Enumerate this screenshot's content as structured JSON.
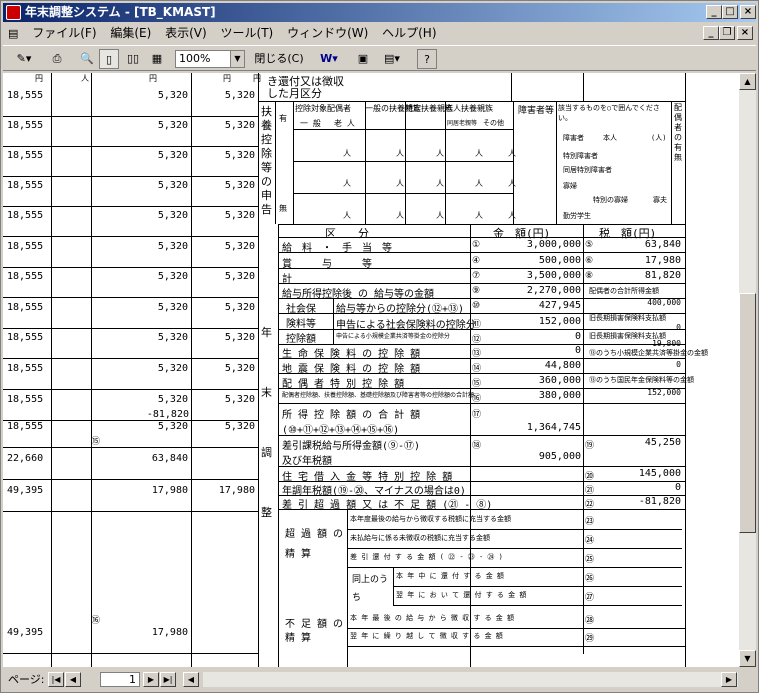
{
  "window": {
    "title": "年末調整システム - [TB_KMAST]"
  },
  "menu": [
    "ファイル(F)",
    "編集(E)",
    "表示(V)",
    "ツール(T)",
    "ウィンドウ(W)",
    "ヘルプ(H)"
  ],
  "toolbar": {
    "zoom": "100%",
    "close_label": "閉じる(C)"
  },
  "left_rows": [
    {
      "a": "18,555",
      "b": "5,320",
      "c": "",
      "d": "5,320"
    },
    {
      "a": "18,555",
      "b": "5,320",
      "c": "",
      "d": "5,320"
    },
    {
      "a": "18,555",
      "b": "5,320",
      "c": "",
      "d": "5,320"
    },
    {
      "a": "18,555",
      "b": "5,320",
      "c": "",
      "d": "5,320"
    },
    {
      "a": "18,555",
      "b": "5,320",
      "c": "",
      "d": "5,320"
    },
    {
      "a": "18,555",
      "b": "5,320",
      "c": "",
      "d": "5,320"
    },
    {
      "a": "18,555",
      "b": "5,320",
      "c": "",
      "d": "5,320"
    },
    {
      "a": "18,555",
      "b": "5,320",
      "c": "",
      "d": "5,320"
    },
    {
      "a": "18,555",
      "b": "5,320",
      "c": "",
      "d": "5,320"
    },
    {
      "a": "18,555",
      "b": "5,320",
      "c": "",
      "d": "5,320"
    },
    {
      "a": "18,555",
      "b": "5,320",
      "c": "",
      "d": "5,320"
    },
    {
      "a": "18,555",
      "b": "5,320",
      "c": "-81,820",
      "d": "5,320"
    },
    {
      "a": "22,660",
      "b": "63,840",
      "c": "",
      "d": ""
    },
    {
      "a": "49,395",
      "b": "17,980",
      "c": "",
      "d": "17,980"
    },
    {
      "a": "49,395",
      "b": "17,980",
      "c": "",
      "d": ""
    }
  ],
  "header_marks": {
    "en1": "円",
    "hito": "人",
    "en2": "円",
    "en3": "円",
    "en4": "円"
  },
  "top_text": {
    "line1": "き還付又は徴収",
    "line2": "した月区分"
  },
  "deps": {
    "side": "扶養控除等の申告",
    "col1": "控除対象配偶者",
    "col1a": "一 般",
    "col1b": "老 人",
    "col2": "一般の扶養親族",
    "col3": "特定扶養親族",
    "col4": "老人扶養親族",
    "col4a": "同居老親等",
    "col4b": "その他",
    "col5": "障害者等",
    "col6": "該当するものを○で囲んでください。",
    "col7": "配偶者の有無",
    "row_labels": [
      "有",
      "無"
    ],
    "unit": "人",
    "notes": [
      "障害者",
      "本人",
      "配偶者",
      "(人)",
      "特別障害者",
      "同居特別障害者",
      "寡婦",
      "特別の寡婦",
      "寡夫",
      "勤労学生"
    ]
  },
  "calc": {
    "h_kubun": "区　　分",
    "h_kingaku": "金　額(円)",
    "h_zeigaku": "税　額(円)",
    "rows": [
      {
        "label": "給　料　・　手　当　等",
        "n1": "①",
        "amt": "3,000,000",
        "n2": "⑤",
        "tax": "63,840"
      },
      {
        "label": "賞　　　与　　　等",
        "n1": "④",
        "amt": "500,000",
        "n2": "⑥",
        "tax": "17,980"
      },
      {
        "label": "計",
        "n1": "⑦",
        "amt": "3,500,000",
        "n2": "⑧",
        "tax": "81,820"
      },
      {
        "label": "給与所得控除後 の 給与等の金額",
        "n1": "⑨",
        "amt": "2,270,000",
        "n2": "",
        "tax": ""
      },
      {
        "label": "給与等からの控除分(⑫+⑬)",
        "n1": "⑩",
        "amt": "427,945",
        "n2": "",
        "tax": ""
      },
      {
        "label": "申告による社会保険料の控除分",
        "n1": "⑪",
        "amt": "152,000",
        "n2": "",
        "tax": ""
      },
      {
        "label": "申告による小規模企業共済等掛金の控除分",
        "n1": "⑫",
        "amt": "0",
        "n2": "",
        "tax": ""
      },
      {
        "label": "生 命 保 険 料 の 控 除 額",
        "n1": "⑬",
        "amt": "0",
        "n2": "",
        "tax": ""
      },
      {
        "label": "地 震 保 険 料 の 控 除 額",
        "n1": "⑭",
        "amt": "44,800",
        "n2": "",
        "tax": ""
      },
      {
        "label": "配 偶 者 特 別 控 除 額",
        "n1": "⑮",
        "amt": "360,000",
        "n2": "",
        "tax": ""
      },
      {
        "label": "配偶者控除額、扶養控除額、基礎控除額及び障害者等の控除額の合計額",
        "n1": "⑯",
        "amt": "380,000",
        "n2": "",
        "tax": ""
      },
      {
        "label": "所 得 控 除 額 の 合 計 額",
        "label2": "(⑩+⑪+⑫+⑬+⑭+⑮+⑯)",
        "n1": "⑰",
        "amt": "1,364,745",
        "n2": "",
        "tax": ""
      },
      {
        "label": "差引課税給与所得金額(⑨-⑰)",
        "label2": "及び年税額",
        "n1": "⑱",
        "amt": "905,000",
        "n2": "⑲",
        "tax": "45,250"
      },
      {
        "label": "住 宅 借 入 金 等 特 別 控 除 額",
        "n1": "",
        "amt": "",
        "n2": "⑳",
        "tax": "145,000"
      },
      {
        "label": "年調年税額(⑲-⑳、マイナスの場合は0)",
        "n1": "",
        "amt": "",
        "n2": "㉑",
        "tax": "0"
      },
      {
        "label": "差 引 超 過 額 又 は 不 足 額 (㉑ - ⑧)",
        "n1": "",
        "amt": "",
        "n2": "㉒",
        "tax": "-81,820"
      }
    ],
    "shakai": "社会保険料等控除額",
    "shakai_l": [
      "社会保",
      "険料等",
      "控除額"
    ],
    "right_notes": {
      "a": "配偶者の合計所得金額",
      "b": "400,000",
      "c": "旧長期損害保険料支払額",
      "d": "0",
      "e": "旧長期損害保険料支払額",
      "f": "19,800",
      "g": "⑬のうち小規模企業共済等掛金の金額",
      "h": "0",
      "i": "⑬のうち国民年金保険料等の金額",
      "j": "152,000"
    },
    "side_label": "年末調整",
    "choka": "超 過 額 の 精 算",
    "choka_rows": [
      "本年度最後の給与から徴収する税額に充当する金額",
      "未払給与に係る未徴収の税額に充当する金額",
      "差 引 還 付 す る 金 額 ( ㉒ - ㉓ - ㉔ )",
      "本 年 中 に 還 付 す る 金 額",
      "翌 年 に お い て 還 付 す る 金 額"
    ],
    "doujou": "同上のうち",
    "fusoku": "不 足 額 の 精 算",
    "fusoku_rows": [
      "本 年 最 後 の 給 与 か ら 徴 収 す る 金 額",
      "翌 年 に 繰 り 越 し て 徴 収 す る 金 額"
    ],
    "choka_nums": [
      "㉓",
      "㉔",
      "㉕",
      "㉖",
      "㉗"
    ],
    "fusoku_nums": [
      "㉘",
      "㉙"
    ],
    "circle_a": "⑮",
    "circle_b": "⑯"
  },
  "status": {
    "page_label": "ページ:",
    "page_value": "1"
  }
}
